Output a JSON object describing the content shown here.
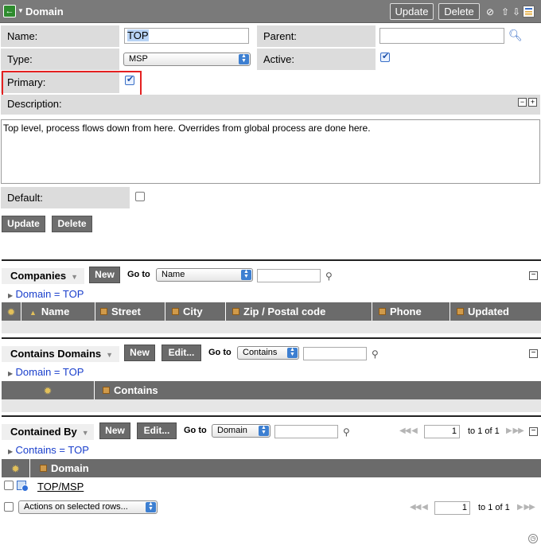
{
  "header": {
    "title": "Domain",
    "update_label": "Update",
    "delete_label": "Delete"
  },
  "form": {
    "name_label": "Name:",
    "name_value": "TOP",
    "parent_label": "Parent:",
    "parent_value": "",
    "type_label": "Type:",
    "type_value": "MSP",
    "active_label": "Active:",
    "active_checked": true,
    "primary_label": "Primary:",
    "primary_checked": true,
    "description_label": "Description:",
    "description_value": "Top level, process flows down from here. Overrides from global process are done here.",
    "default_label": "Default:",
    "default_checked": false,
    "update_label": "Update",
    "delete_label": "Delete"
  },
  "companies": {
    "title": "Companies",
    "new_label": "New",
    "goto_label": "Go to",
    "goto_select": "Name",
    "filter": "Domain = TOP",
    "columns": [
      "Name",
      "Street",
      "City",
      "Zip / Postal code",
      "Phone",
      "Updated"
    ]
  },
  "contains_domains": {
    "title": "Contains Domains",
    "new_label": "New",
    "edit_label": "Edit...",
    "goto_label": "Go to",
    "goto_select": "Contains",
    "filter": "Domain = TOP",
    "columns": [
      "Contains"
    ]
  },
  "contained_by": {
    "title": "Contained By",
    "new_label": "New",
    "edit_label": "Edit...",
    "goto_label": "Go to",
    "goto_select": "Domain",
    "filter": "Contains = TOP",
    "page_value": "1",
    "page_text": "to 1 of 1",
    "columns": [
      "Domain"
    ],
    "rows": [
      {
        "domain": "TOP/MSP"
      }
    ],
    "actions_select": "Actions on selected rows...",
    "bottom_page_value": "1",
    "bottom_page_text": "to 1 of 1"
  },
  "colors": {
    "header_bg": "#7a7a7a",
    "label_bg": "#dcdcdc",
    "button_bg": "#6e6e6e",
    "link": "#1a3fcc",
    "highlight_border": "#e42020"
  }
}
